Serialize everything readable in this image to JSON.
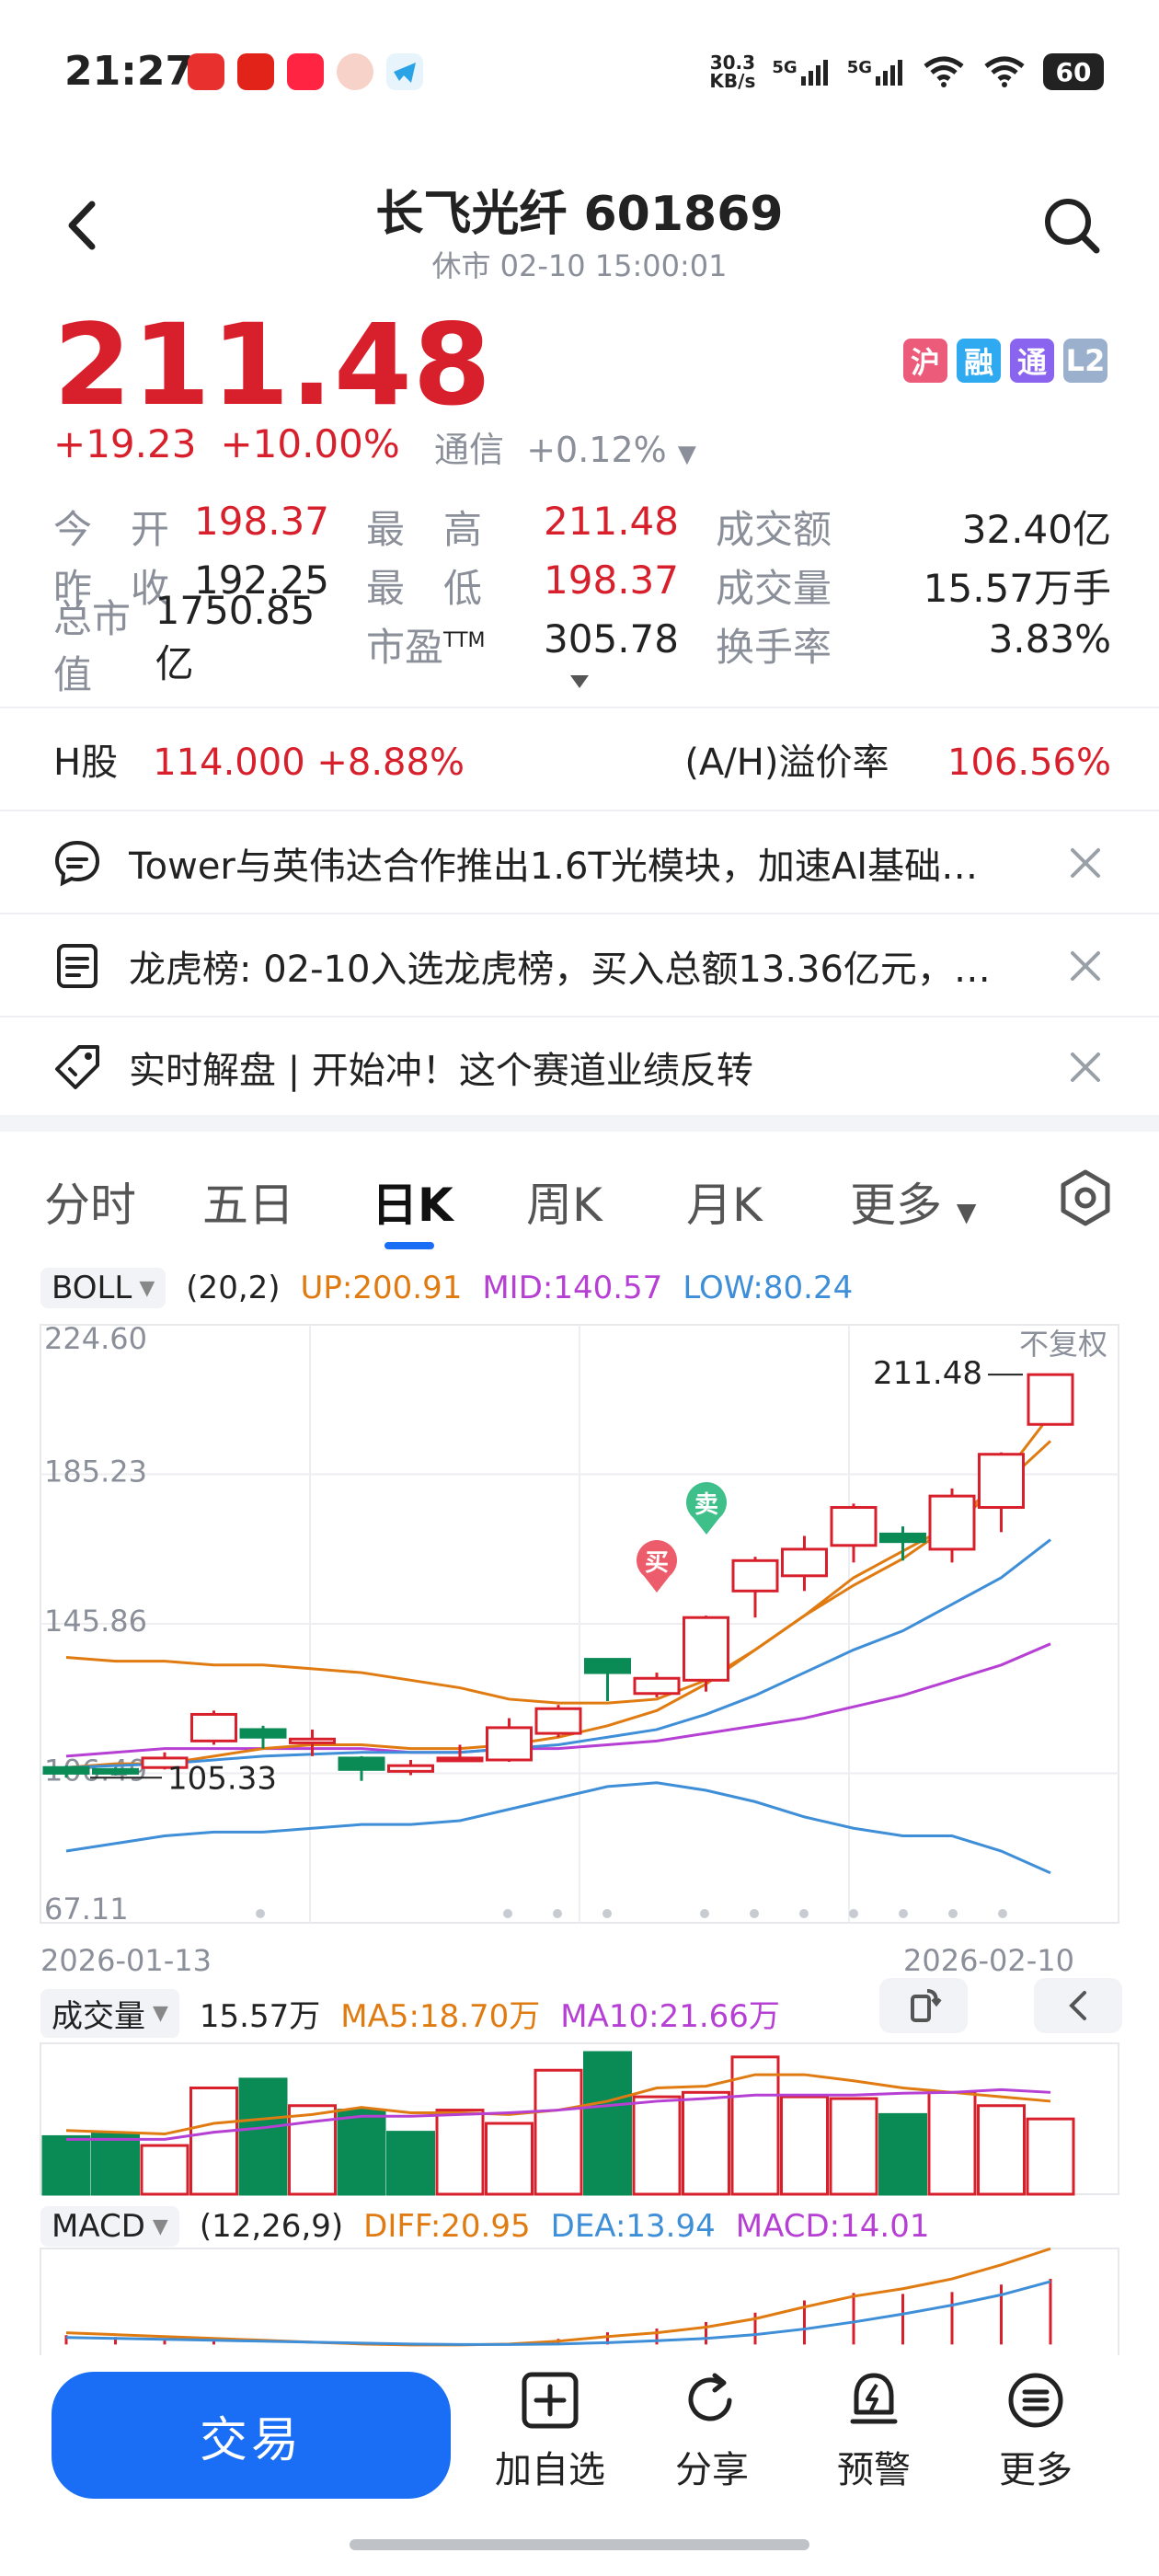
{
  "status_bar": {
    "time": "21:27",
    "net_speed_top": "30.3",
    "net_speed_bottom": "KB/s",
    "sig1": "5G",
    "sig2": "5G",
    "battery": "60"
  },
  "header": {
    "title": "长飞光纤 601869",
    "subtitle": "休市 02-10 15:00:01"
  },
  "quote": {
    "price": "211.48",
    "change": "+19.23",
    "change_pct": "+10.00%",
    "industry": "通信",
    "industry_pct": "+0.12%",
    "badges": [
      {
        "label": "沪",
        "color": "#ec5c7a"
      },
      {
        "label": "融",
        "color": "#2fa9f0"
      },
      {
        "label": "通",
        "color": "#8a63ee"
      },
      {
        "label": "L2",
        "color": "#9bb0cc"
      }
    ]
  },
  "stats": [
    [
      {
        "label": "今　开",
        "value": "198.37",
        "red": true
      },
      {
        "label": "最　高",
        "value": "211.48",
        "red": true
      },
      {
        "label": "成交额",
        "value": "32.40亿",
        "red": false
      }
    ],
    [
      {
        "label": "昨　收",
        "value": "192.25",
        "red": false
      },
      {
        "label": "最　低",
        "value": "198.37",
        "red": true
      },
      {
        "label": "成交量",
        "value": "15.57万手",
        "red": false
      }
    ],
    [
      {
        "label": "总市值",
        "value": "1750.85亿",
        "red": false
      },
      {
        "label": "市盈",
        "sup": "TTM",
        "value": "305.78",
        "red": false
      },
      {
        "label": "换手率",
        "value": "3.83%",
        "red": false
      }
    ]
  ],
  "hshare": {
    "label": "H股",
    "value": "114.000",
    "pct": "+8.88%",
    "premium_label": "(A/H)溢价率",
    "premium": "106.56%"
  },
  "news": [
    {
      "icon": "chat-icon",
      "text": "Tower与英伟达合作推出1.6T光模块，加速AI基础…"
    },
    {
      "icon": "list-icon",
      "text": "龙虎榜: 02-10入选龙虎榜，买入总额13.36亿元，…"
    },
    {
      "icon": "tag-icon",
      "text": "实时解盘 | 开始冲！这个赛道业绩反转"
    }
  ],
  "tabs": [
    "分时",
    "五日",
    "日K",
    "周K",
    "月K",
    "更多"
  ],
  "active_tab": "日K",
  "boll": {
    "name": "BOLL",
    "params": "(20,2)",
    "up": "UP:200.91",
    "mid": "MID:140.57",
    "low": "LOW:80.24",
    "up_color": "#e07b12",
    "mid_color": "#b640d4",
    "low_color": "#3e8ed8"
  },
  "volume": {
    "name": "成交量",
    "value": "15.57万",
    "ma5": "MA5:18.70万",
    "ma10": "MA10:21.66万"
  },
  "macd": {
    "name": "MACD",
    "params": "(12,26,9)",
    "diff": "DIFF:20.95",
    "dea": "DEA:13.94",
    "macd": "MACD:14.01"
  },
  "chart_labels": {
    "no_adjust": "不复权",
    "high_mark": "211.48",
    "low_mark": "105.33",
    "start_date": "2026-01-13",
    "end_date": "2026-02-10",
    "buy": "买",
    "sell": "卖"
  },
  "chart_data": {
    "type": "candlestick",
    "ylim": [
      67.11,
      224.6
    ],
    "y_ticks": [
      "224.60",
      "185.23",
      "145.86",
      "106.49",
      "67.11"
    ],
    "x": [
      "2026-01-13",
      "2026-02-10"
    ],
    "candles": [
      {
        "open": 108.0,
        "close": 106.5,
        "high": 108.5,
        "low": 105.33
      },
      {
        "open": 107.5,
        "close": 106.5,
        "high": 108.0,
        "low": 106.0
      },
      {
        "open": 108.0,
        "close": 110.5,
        "high": 112.0,
        "low": 107.5
      },
      {
        "open": 115.0,
        "close": 122.0,
        "high": 123.0,
        "low": 114.0
      },
      {
        "open": 118.0,
        "close": 116.0,
        "high": 119.0,
        "low": 113.0
      },
      {
        "open": 114.5,
        "close": 115.5,
        "high": 118.0,
        "low": 111.0
      },
      {
        "open": 110.5,
        "close": 107.5,
        "high": 111.0,
        "low": 104.5
      },
      {
        "open": 107.0,
        "close": 108.5,
        "high": 110.0,
        "low": 106.0
      },
      {
        "open": 110.0,
        "close": 110.5,
        "high": 114.0,
        "low": 109.5
      },
      {
        "open": 110.0,
        "close": 118.5,
        "high": 121.0,
        "low": 109.5
      },
      {
        "open": 117.0,
        "close": 123.5,
        "high": 124.5,
        "low": 116.0
      },
      {
        "open": 136.5,
        "close": 133.0,
        "high": 136.5,
        "low": 125.5
      },
      {
        "open": 127.5,
        "close": 131.5,
        "high": 133.0,
        "low": 126.5
      },
      {
        "open": 131.0,
        "close": 147.5,
        "high": 148.0,
        "low": 128.0
      },
      {
        "open": 154.5,
        "close": 162.5,
        "high": 163.5,
        "low": 147.5
      },
      {
        "open": 158.5,
        "close": 165.5,
        "high": 169.0,
        "low": 154.5
      },
      {
        "open": 166.5,
        "close": 176.5,
        "high": 177.5,
        "low": 162.0
      },
      {
        "open": 169.5,
        "close": 167.5,
        "high": 171.5,
        "low": 162.5
      },
      {
        "open": 165.5,
        "close": 179.5,
        "high": 181.5,
        "low": 162.0
      },
      {
        "open": 176.5,
        "close": 190.5,
        "high": 191.0,
        "low": 170.0
      },
      {
        "open": 198.37,
        "close": 211.48,
        "high": 211.48,
        "low": 198.37
      }
    ],
    "series": [
      {
        "name": "UP",
        "color": "#e07b12",
        "values": [
          137,
          136,
          136,
          135,
          135,
          134,
          133,
          131,
          129,
          126,
          125,
          125,
          126,
          131,
          139,
          148,
          156,
          163,
          172,
          184,
          200.91
        ]
      },
      {
        "name": "MID",
        "color": "#b640d4",
        "values": [
          111,
          112,
          113,
          113,
          113,
          113,
          113,
          112,
          112,
          113,
          113,
          114,
          115,
          117,
          119,
          121,
          124,
          127,
          131,
          135,
          140.57
        ]
      },
      {
        "name": "LOW",
        "color": "#3e8ed8",
        "values": [
          86,
          88,
          90,
          91,
          91,
          92,
          93,
          93,
          94,
          97,
          100,
          103,
          104,
          102,
          99,
          95,
          92,
          90,
          90,
          86,
          80.24
        ]
      },
      {
        "name": "MA-orange",
        "color": "#e07b12",
        "values": [
          108,
          109,
          109,
          111,
          113,
          114,
          114,
          113,
          113,
          114,
          116,
          119,
          123,
          130,
          139,
          148,
          158,
          165,
          172,
          182,
          194
        ]
      },
      {
        "name": "MA-blue",
        "color": "#3e8ed8",
        "values": [
          108,
          108.5,
          109,
          110,
          111,
          111.5,
          112,
          112,
          112,
          113,
          114,
          116,
          118,
          122,
          127,
          133,
          139,
          144,
          151,
          158,
          168
        ]
      }
    ],
    "volume_bars": [
      {
        "v": 0.65,
        "up": false
      },
      {
        "v": 0.68,
        "up": false
      },
      {
        "v": 0.55,
        "up": true
      },
      {
        "v": 1.2,
        "up": true
      },
      {
        "v": 1.3,
        "up": false
      },
      {
        "v": 1.0,
        "up": true
      },
      {
        "v": 0.95,
        "up": false
      },
      {
        "v": 0.7,
        "up": false
      },
      {
        "v": 0.95,
        "up": true
      },
      {
        "v": 0.8,
        "up": true
      },
      {
        "v": 1.4,
        "up": true
      },
      {
        "v": 1.6,
        "up": false
      },
      {
        "v": 1.1,
        "up": true
      },
      {
        "v": 1.15,
        "up": true
      },
      {
        "v": 1.55,
        "up": true
      },
      {
        "v": 1.1,
        "up": true
      },
      {
        "v": 1.08,
        "up": true
      },
      {
        "v": 0.9,
        "up": false
      },
      {
        "v": 1.15,
        "up": true
      },
      {
        "v": 1.0,
        "up": true
      },
      {
        "v": 0.85,
        "up": true
      }
    ],
    "volume_ma": [
      {
        "name": "MA5",
        "color": "#e07b12",
        "values": [
          0.72,
          0.7,
          0.68,
          0.8,
          0.85,
          0.9,
          0.98,
          0.92,
          0.92,
          0.9,
          0.95,
          1.05,
          1.2,
          1.22,
          1.35,
          1.35,
          1.28,
          1.2,
          1.15,
          1.1,
          1.05
        ]
      },
      {
        "name": "MA10",
        "color": "#b640d4",
        "values": [
          0.62,
          0.62,
          0.62,
          0.7,
          0.75,
          0.82,
          0.88,
          0.88,
          0.9,
          0.92,
          0.95,
          1.0,
          1.05,
          1.08,
          1.12,
          1.12,
          1.12,
          1.14,
          1.15,
          1.18,
          1.15
        ]
      }
    ],
    "macd_diff": [
      3.0,
      2.6,
      2.2,
      1.8,
      1.4,
      1.0,
      0.6,
      0.4,
      0.4,
      0.6,
      1.2,
      2.2,
      3.0,
      4.2,
      6.0,
      8.5,
      10.8,
      12.4,
      14.5,
      17.5,
      20.95
    ],
    "macd_dea": [
      2.0,
      1.8,
      1.6,
      1.4,
      1.2,
      1.0,
      0.8,
      0.6,
      0.5,
      0.5,
      0.6,
      0.9,
      1.3,
      1.8,
      2.6,
      3.8,
      5.3,
      7.0,
      8.9,
      11.1,
      13.94
    ]
  },
  "bottom_bar": {
    "trade": "交易",
    "items": [
      "加自选",
      "分享",
      "预警",
      "更多"
    ]
  }
}
